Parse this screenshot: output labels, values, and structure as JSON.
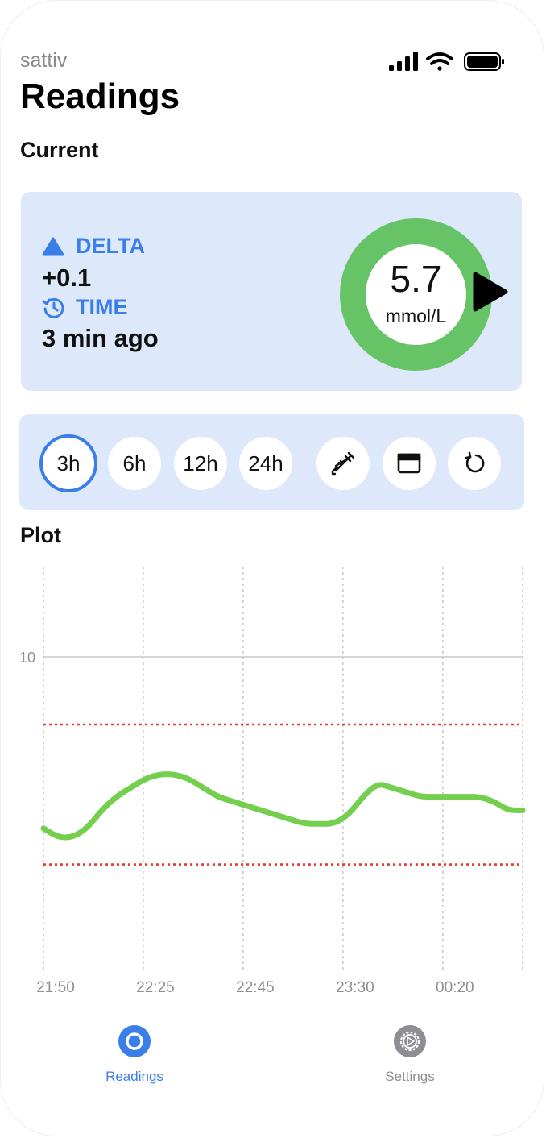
{
  "status_bar": {
    "carrier": "sattiv"
  },
  "header": {
    "title": "Readings"
  },
  "current": {
    "section_title": "Current",
    "delta_label": "DELTA",
    "delta_value": "+0.1",
    "time_label": "TIME",
    "time_value": "3 min ago",
    "glucose_value": "5.7",
    "glucose_unit": "mmol/L",
    "ring_color": "#66c466"
  },
  "toolbar": {
    "ranges": [
      "3h",
      "6h",
      "12h",
      "24h"
    ],
    "selected_range": "3h",
    "actions": [
      "syringe-icon",
      "window-icon",
      "refresh-icon"
    ]
  },
  "plot": {
    "section_title": "Plot"
  },
  "chart_data": {
    "type": "line",
    "y_tick_labels": [
      "10"
    ],
    "x_tick_labels": [
      "21:50",
      "22:25",
      "22:45",
      "23:30",
      "00:20"
    ],
    "ylim": [
      3,
      12
    ],
    "target_low": 5.4,
    "target_high": 8.5,
    "series": [
      {
        "color": "#73cf4d",
        "values": [
          6.2,
          6.0,
          6.0,
          6.2,
          6.6,
          6.9,
          7.1,
          7.3,
          7.4,
          7.4,
          7.3,
          7.1,
          6.9,
          6.8,
          6.7,
          6.6,
          6.5,
          6.4,
          6.3,
          6.3,
          6.3,
          6.5,
          6.9,
          7.2,
          7.1,
          7.0,
          6.9,
          6.9,
          6.9,
          6.9,
          6.9,
          6.8,
          6.6,
          6.6
        ]
      }
    ],
    "grid": true,
    "line_color": "#73cf4d",
    "target_line_color": "#e53935"
  },
  "tabbar": {
    "items": [
      {
        "label": "Readings",
        "icon": "readings-icon",
        "active": true
      },
      {
        "label": "Settings",
        "icon": "settings-gear-icon",
        "active": false
      }
    ],
    "active_color": "#3a7fe8",
    "inactive_color": "#8e8e93"
  }
}
